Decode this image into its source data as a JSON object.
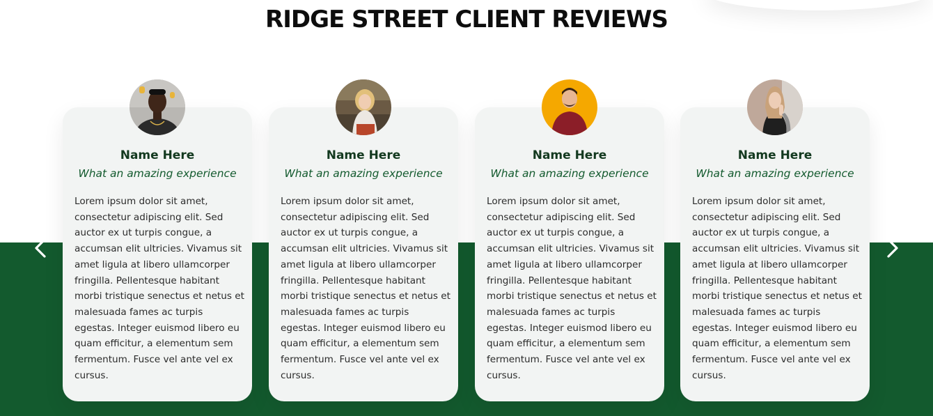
{
  "section": {
    "title": "RIDGE STREET CLIENT REVIEWS"
  },
  "carousel": {
    "prev_icon": "chevron-left-icon",
    "next_icon": "chevron-right-icon"
  },
  "colors": {
    "brand_green": "#135a2e",
    "name_color": "#13391f",
    "card_bg": "#f2f4f3",
    "avatar_3_bg": "#f5a800"
  },
  "reviews": [
    {
      "name": "Name Here",
      "tagline": "What an amazing experience",
      "text": "Lorem ipsum dolor sit amet, consectetur adipiscing elit. Sed auctor ex ut turpis congue, a accumsan elit ultricies. Vivamus sit amet ligula at libero ullamcorper fringilla. Pellentesque habitant morbi tristique senectus et netus et malesuada fames ac turpis egestas. Integer euismod libero eu quam efficitur, a elementum sem fermentum. Fusce vel ante vel ex cursus."
    },
    {
      "name": "Name Here",
      "tagline": "What an amazing experience",
      "text": "Lorem ipsum dolor sit amet, consectetur adipiscing elit. Sed auctor ex ut turpis congue, a accumsan elit ultricies. Vivamus sit amet ligula at libero ullamcorper fringilla. Pellentesque habitant morbi tristique senectus et netus et malesuada fames ac turpis egestas. Integer euismod libero eu quam efficitur, a elementum sem fermentum. Fusce vel ante vel ex cursus."
    },
    {
      "name": "Name Here",
      "tagline": "What an amazing experience",
      "text": "Lorem ipsum dolor sit amet, consectetur adipiscing elit. Sed auctor ex ut turpis congue, a accumsan elit ultricies. Vivamus sit amet ligula at libero ullamcorper fringilla. Pellentesque habitant morbi tristique senectus et netus et malesuada fames ac turpis egestas. Integer euismod libero eu quam efficitur, a elementum sem fermentum. Fusce vel ante vel ex cursus."
    },
    {
      "name": "Name Here",
      "tagline": "What an amazing experience",
      "text": "Lorem ipsum dolor sit amet, consectetur adipiscing elit. Sed auctor ex ut turpis congue, a accumsan elit ultricies. Vivamus sit amet ligula at libero ullamcorper fringilla. Pellentesque habitant morbi tristique senectus et netus et malesuada fames ac turpis egestas. Integer euismod libero eu quam efficitur, a elementum sem fermentum. Fusce vel ante vel ex cursus."
    }
  ]
}
